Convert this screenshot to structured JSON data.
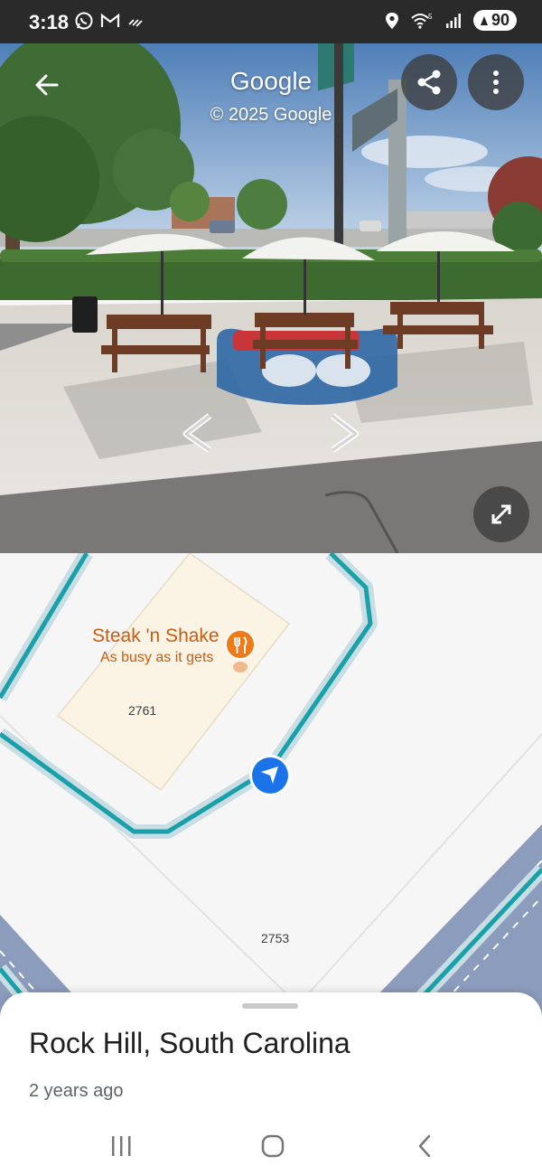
{
  "status_bar": {
    "time": "3:18",
    "battery": "90",
    "left_icons": [
      "whatsapp-icon",
      "gmail-icon",
      "missed-call-icon"
    ],
    "right_icons": [
      "location-icon",
      "wifi-icon",
      "signal-icon",
      "battery-icon"
    ]
  },
  "street_view": {
    "title": "Google",
    "copyright": "© 2025 Google",
    "buttons": {
      "back": "back-arrow-icon",
      "share": "share-icon",
      "more": "more-vert-icon",
      "expand": "expand-icon"
    }
  },
  "map": {
    "poi": {
      "name": "Steak 'n Shake",
      "status": "As busy as it gets",
      "icon": "restaurant-icon",
      "color": "#c75d14"
    },
    "addresses": [
      "2761",
      "2753"
    ],
    "route_color": "#1aa0a8",
    "marker_color": "#1a73e8"
  },
  "place": {
    "name": "Rock Hill, South Carolina",
    "date": "2 years ago"
  },
  "nav_bar": {
    "recents": "recents-icon",
    "home": "home-icon",
    "back": "back-icon"
  }
}
